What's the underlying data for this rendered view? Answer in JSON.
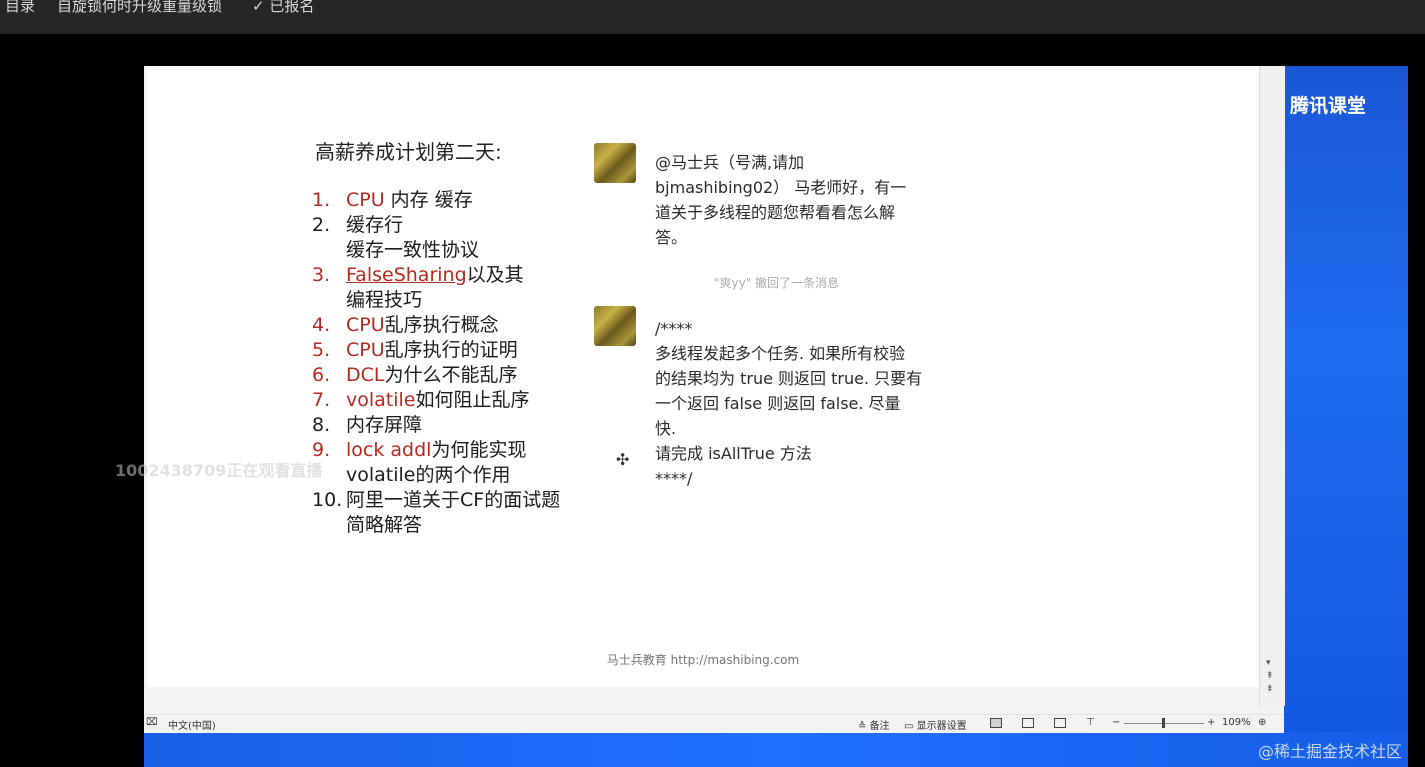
{
  "topbar": {
    "item1": "目录",
    "item2": "自旋锁何时升级重量级锁",
    "item3": "✓ 已报名"
  },
  "brand": {
    "name": "腾讯课堂"
  },
  "slide": {
    "title": "高薪养成计划第二天:",
    "toc": [
      {
        "num": "1.",
        "red": "CPU",
        "rest": " 内存 缓存",
        "numRed": true
      },
      {
        "num": "2.",
        "red": "",
        "rest": "缓存行",
        "numRed": false
      },
      {
        "num": "",
        "red": "",
        "rest": "缓存一致性协议",
        "numRed": false
      },
      {
        "num": "3.",
        "red": "FalseSharing",
        "rest": "以及其",
        "numRed": true
      },
      {
        "num": "",
        "red": "",
        "rest": "编程技巧",
        "numRed": false
      },
      {
        "num": "4.",
        "red": "CPU",
        "rest": "乱序执行概念",
        "numRed": true
      },
      {
        "num": "5.",
        "red": "CPU",
        "rest": "乱序执行的证明",
        "numRed": true
      },
      {
        "num": "6.",
        "red": "DCL",
        "rest": "为什么不能乱序",
        "numRed": true
      },
      {
        "num": "7.",
        "red": "volatile",
        "rest": "如何阻止乱序",
        "numRed": true
      },
      {
        "num": "8.",
        "red": "",
        "rest": "内存屏障",
        "numRed": false
      },
      {
        "num": "9.",
        "red": "lock addl",
        "rest": "为何能实现",
        "numRed": true
      },
      {
        "num": "",
        "red": "",
        "rest": "volatile的两个作用",
        "numRed": false
      },
      {
        "num": "10.",
        "red": "",
        "rest": "阿里一道关于CF的面试题",
        "numRed": false
      },
      {
        "num": "",
        "red": "",
        "rest": "简略解答",
        "numRed": false
      }
    ],
    "chat1": [
      "@马士兵（号满,请加",
      "bjmashibing02） 马老师好，有一",
      "道关于多线程的题您帮看看怎么解",
      "答。"
    ],
    "recall": "\"爽yy\" 撤回了一条消息",
    "chat2": [
      "/****",
      "多线程发起多个任务. 如果所有校验",
      "的结果均为 true 则返回 true. 只要有",
      "一个返回 false 则返回 false. 尽量",
      "快.",
      "请完成 isAllTrue 方法",
      "****/"
    ],
    "footer": "马士兵教育 http://mashibing.com"
  },
  "watermark": "1002438709正在观看直播",
  "statusbar": {
    "lang": "中文(中国)",
    "notes": "备注",
    "display": "显示器设置",
    "zoom": "109%"
  },
  "credit": "@稀土掘金技术社区"
}
